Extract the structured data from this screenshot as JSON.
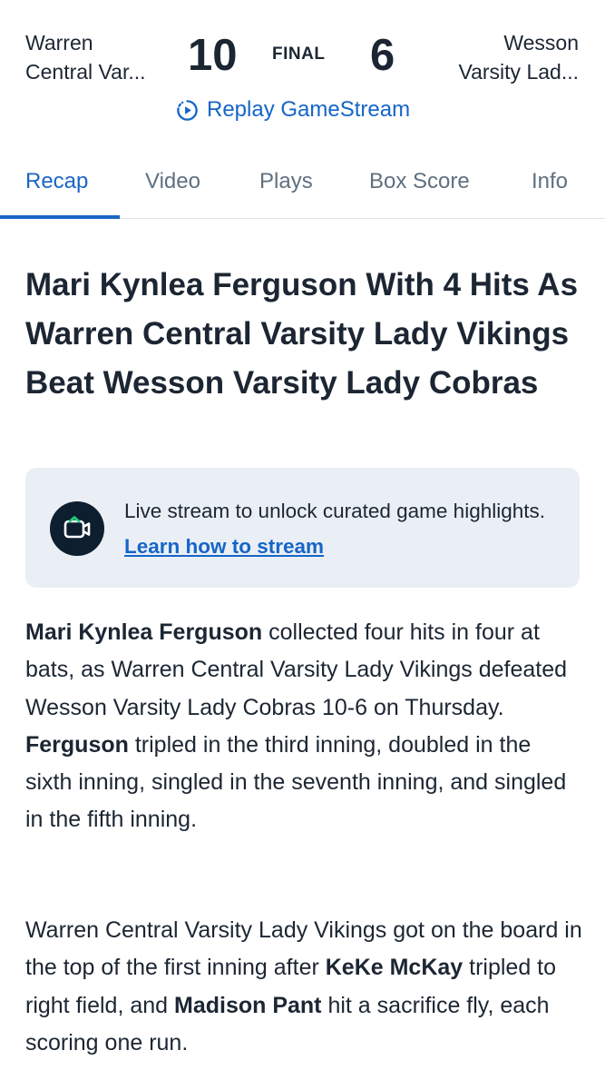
{
  "scoreboard": {
    "home_team_line1": "Warren",
    "home_team_line2": "Central Var...",
    "home_score": "10",
    "status": "FINAL",
    "away_score": "6",
    "away_team_line1": "Wesson",
    "away_team_line2": "Varsity Lad...",
    "replay_label": "Replay GameStream",
    "replay_icon": "replay-icon",
    "accent_color": "#1565c8"
  },
  "tabs": [
    {
      "label": "Recap",
      "active": true
    },
    {
      "label": "Video",
      "active": false
    },
    {
      "label": "Plays",
      "active": false
    },
    {
      "label": "Box Score",
      "active": false
    },
    {
      "label": "Info",
      "active": false
    }
  ],
  "article": {
    "headline": "Mari Kynlea Ferguson With 4 Hits As Warren Central Varsity Lady Vikings Beat Wesson Varsity Lady Cobras",
    "promo": {
      "icon": "video-camera-icon",
      "text": "Live stream to unlock curated game highlights. ",
      "link": "Learn how to stream"
    },
    "paragraph1": {
      "b1": "Mari Kynlea Ferguson",
      "t1": " collected four hits in four at bats, as Warren Central Varsity Lady Vikings defeated Wesson Varsity Lady Cobras 10-6 on Thursday. ",
      "b2": "Ferguson",
      "t2": " tripled in the third inning, doubled in the sixth inning, singled in the seventh inning, and singled in the fifth inning."
    },
    "paragraph2": {
      "t1": "Warren Central Varsity Lady Vikings got on the board in the top of the first inning after ",
      "b1": "KeKe McKay",
      "t2": " tripled to right field, and ",
      "b2": "Madison Pant",
      "t3": " hit a sacrifice fly, each scoring one run."
    }
  }
}
